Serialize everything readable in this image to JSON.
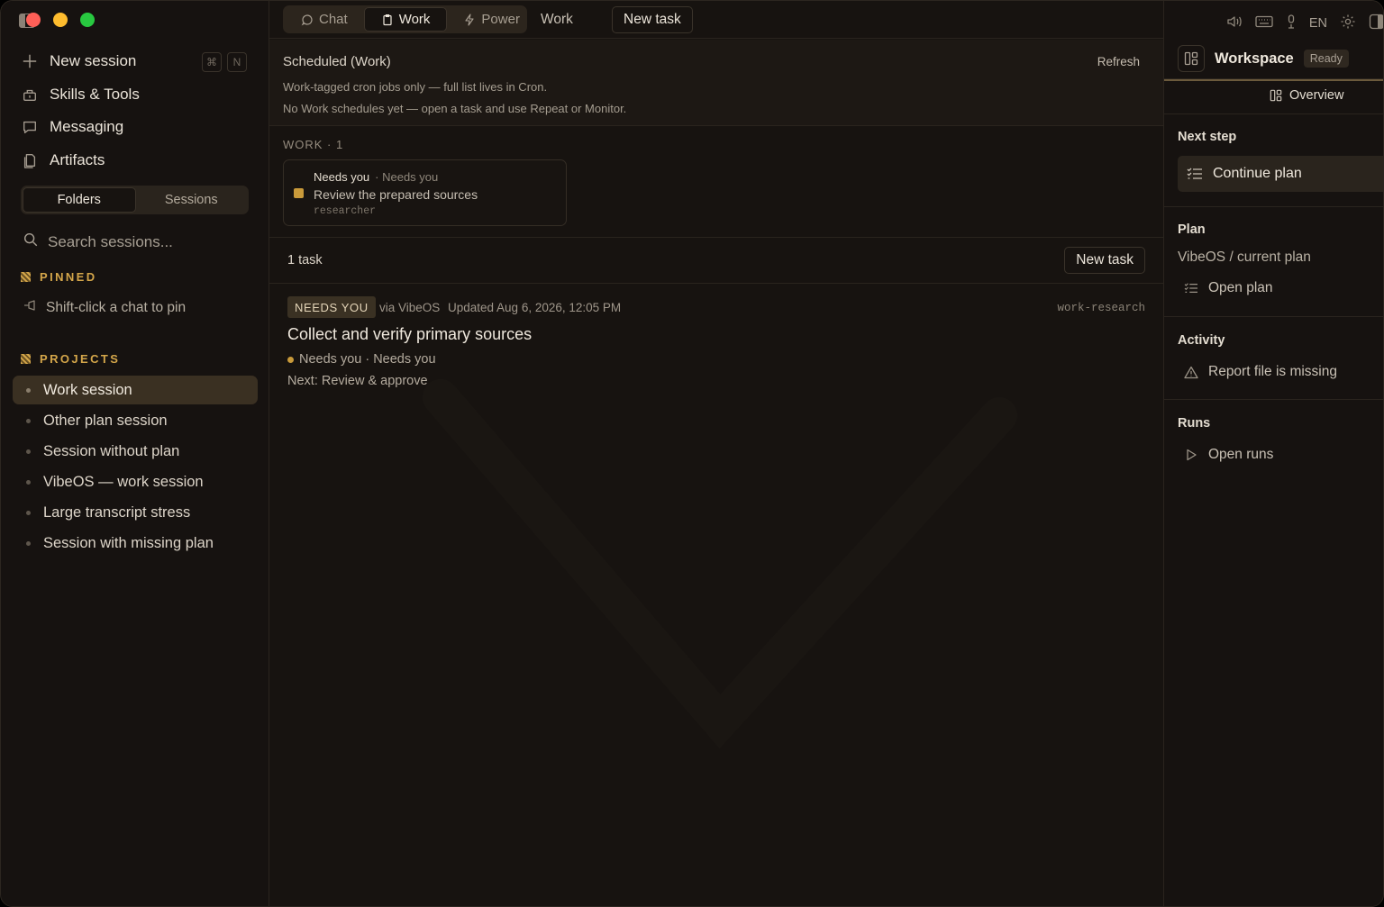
{
  "sidebar": {
    "nav": [
      {
        "label": "New session",
        "icon": "plus-icon"
      },
      {
        "label": "Skills & Tools",
        "icon": "tools-icon"
      },
      {
        "label": "Messaging",
        "icon": "chat-bubble-icon"
      },
      {
        "label": "Artifacts",
        "icon": "files-icon"
      }
    ],
    "shortcut_cmd": "⌘",
    "shortcut_key": "N",
    "tabs": {
      "folders": "Folders",
      "sessions": "Sessions"
    },
    "search_placeholder": "Search sessions...",
    "pinned_heading": "PINNED",
    "pin_hint": "Shift-click a chat to pin",
    "projects_heading": "PROJECTS",
    "projects": [
      {
        "label": "Work session",
        "active": true
      },
      {
        "label": "Other plan session"
      },
      {
        "label": "Session without plan"
      },
      {
        "label": "VibeOS — work session"
      },
      {
        "label": "Large transcript stress"
      },
      {
        "label": "Session with missing plan"
      }
    ]
  },
  "topbar": {
    "modes": {
      "chat": "Chat",
      "work": "Work",
      "power": "Power"
    },
    "section": "Work",
    "new_task": "New task"
  },
  "scheduled": {
    "title": "Scheduled (Work)",
    "refresh": "Refresh",
    "line1": "Work-tagged cron jobs only — full list lives in Cron.",
    "line2": "No Work schedules yet — open a task and use Repeat or Monitor."
  },
  "work_group": {
    "heading": "WORK · 1",
    "card": {
      "title": "Needs you",
      "subtitle": "· Needs you",
      "text": "Review the prepared sources",
      "agent": "researcher"
    }
  },
  "tasks_bar": {
    "count": "1 task",
    "new_task": "New task"
  },
  "task": {
    "badge": "NEEDS YOU",
    "via": "via VibeOS",
    "updated": "Updated Aug 6, 2026, 12:05 PM",
    "tag": "work-research",
    "title": "Collect and verify primary sources",
    "status": "Needs you · Needs you",
    "next": "Next: Review & approve"
  },
  "right_panel": {
    "lang": "EN",
    "workspace": "Workspace",
    "ready": "Ready",
    "overview": "Overview",
    "next_step_h": "Next step",
    "continue_plan": "Continue plan",
    "plan_h": "Plan",
    "plan_path": "VibeOS / current plan",
    "open_plan": "Open plan",
    "activity_h": "Activity",
    "activity_item": "Report file is missing",
    "runs_h": "Runs",
    "open_runs": "Open runs"
  },
  "colors": {
    "accent": "#d4a64a",
    "status_dot": "#c99a3a",
    "background": "#171310"
  }
}
